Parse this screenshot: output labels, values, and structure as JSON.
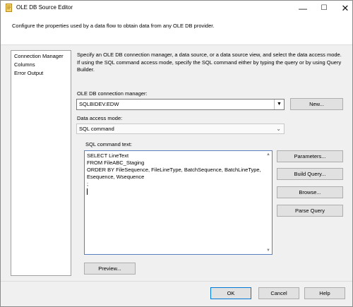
{
  "window": {
    "title": "OLE DB Source Editor",
    "minimize_glyph": "—",
    "maximize_glyph": "☐",
    "close_glyph": "✕"
  },
  "header": {
    "description": "Configure the properties used by a data flow to obtain data from any OLE DB provider."
  },
  "nav": {
    "items": [
      {
        "label": "Connection Manager"
      },
      {
        "label": "Columns"
      },
      {
        "label": "Error Output"
      }
    ]
  },
  "main": {
    "instructions": "Specify an OLE DB connection manager, a data source, or a data source view, and select the data access mode. If using the SQL command access mode, specify the SQL command either by typing the query or by using Query Builder.",
    "connection_label": "OLE DB connection manager:",
    "connection_value": "SQLBIDEV.EDW",
    "new_button": "New...",
    "access_mode_label": "Data access mode:",
    "access_mode_value": "SQL command",
    "sql_label": "SQL command text:",
    "sql_lines": [
      "SELECT LineText",
      "FROM FileABC_Staging",
      "ORDER BY FileSequence, FileLineType, BatchSequence, BatchLineType,",
      "Esequence, Wsequence",
      ";"
    ],
    "side_buttons": {
      "parameters": "Parameters...",
      "build_query": "Build Query...",
      "browse": "Browse...",
      "parse_query": "Parse Query"
    },
    "preview_button": "Preview..."
  },
  "footer": {
    "ok": "OK",
    "cancel": "Cancel",
    "help": "Help"
  }
}
